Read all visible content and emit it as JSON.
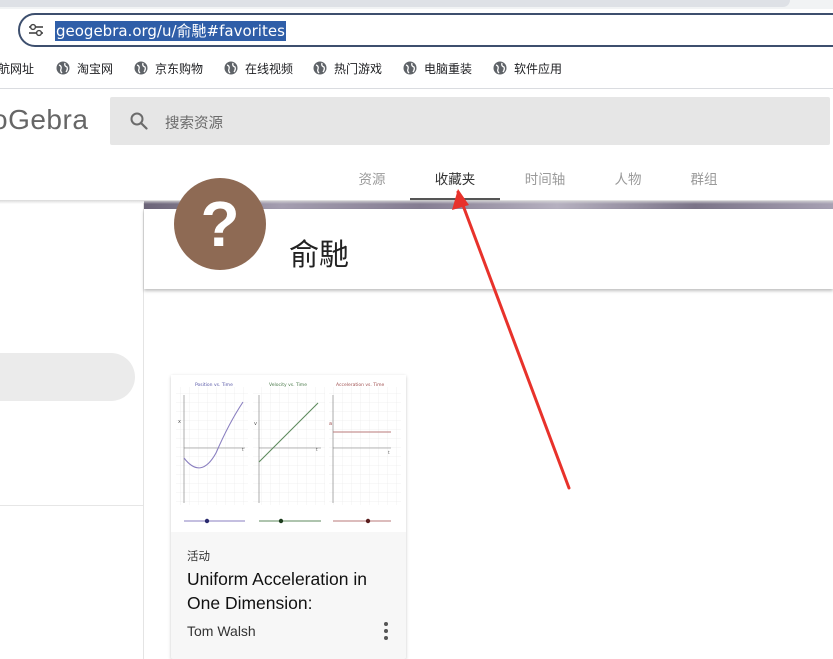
{
  "browser": {
    "url": "geogebra.org/u/俞馳#favorites",
    "bookmarks": [
      {
        "label": "航网址",
        "icon": "none"
      },
      {
        "label": "淘宝网",
        "icon": "globe-icon"
      },
      {
        "label": "京东购物",
        "icon": "globe-icon"
      },
      {
        "label": "在线视频",
        "icon": "globe-icon"
      },
      {
        "label": "热门游戏",
        "icon": "globe-icon"
      },
      {
        "label": "电脑重装",
        "icon": "globe-icon"
      },
      {
        "label": "软件应用",
        "icon": "globe-icon"
      }
    ]
  },
  "header": {
    "logo": "oGebra",
    "search_placeholder": "搜索资源"
  },
  "tabs": [
    {
      "label": "资源",
      "active": false
    },
    {
      "label": "收藏夹",
      "active": true
    },
    {
      "label": "时间轴",
      "active": false
    },
    {
      "label": "人物",
      "active": false
    },
    {
      "label": "群组",
      "active": false
    }
  ],
  "profile": {
    "name": "俞馳",
    "avatar_glyph": "?",
    "avatar_color": "#8e6a54"
  },
  "card": {
    "type": "活动",
    "title": "Uniform Acceleration in One Dimension:",
    "author": "Tom Walsh",
    "thumbnail_labels": [
      "Position vs. Time",
      "Velocity vs. Time",
      "Acceleration vs. Time"
    ],
    "axis_labels": {
      "x1": "x",
      "v": "v",
      "a": "a",
      "t": "t"
    }
  },
  "colors": {
    "annotation_arrow": "#e8322b",
    "url_highlight": "#2f5ea8"
  }
}
